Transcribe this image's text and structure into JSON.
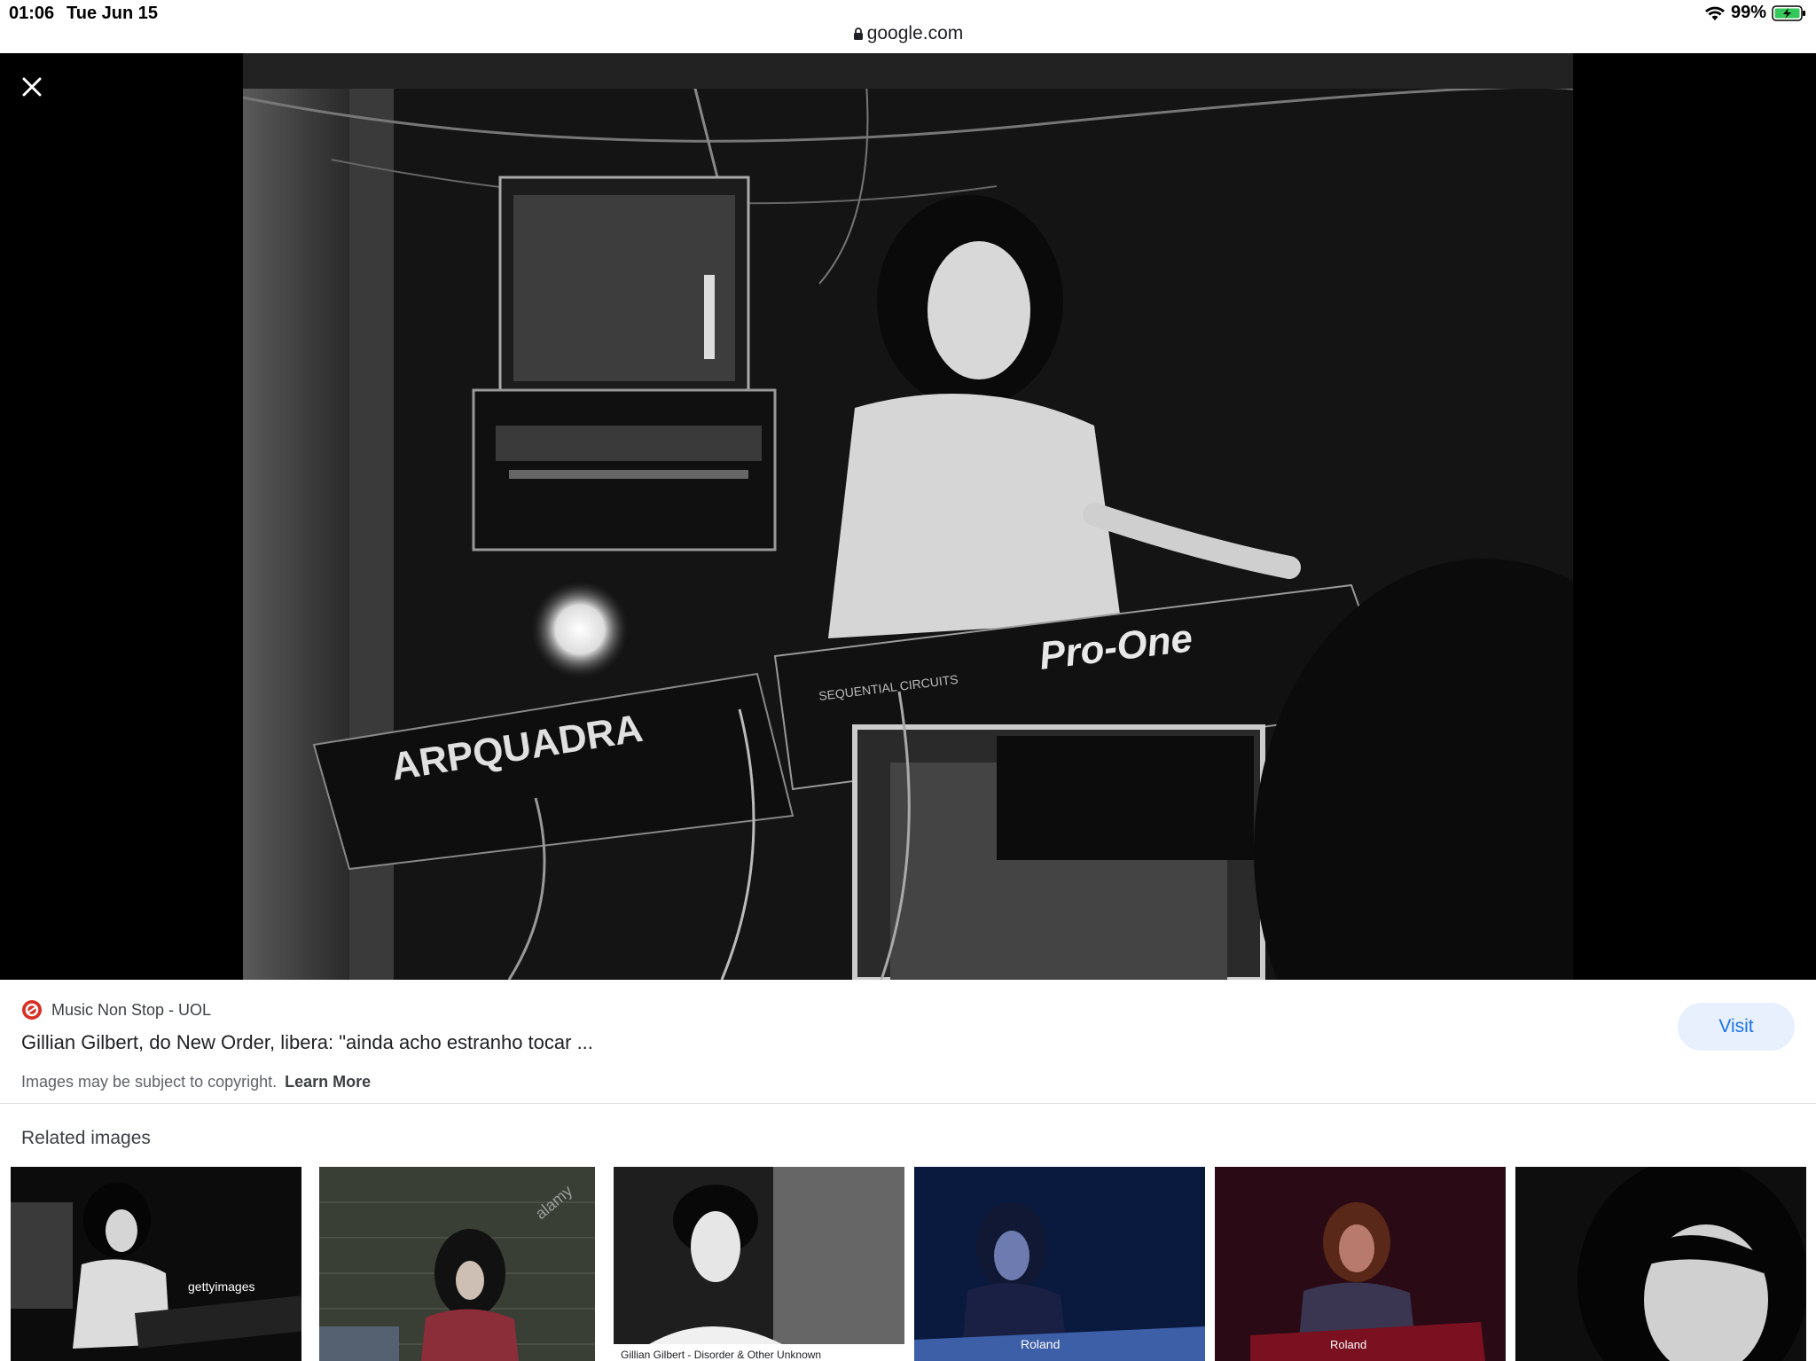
{
  "status_bar": {
    "time": "01:06",
    "date": "Tue Jun 15",
    "battery": "99%"
  },
  "url_bar": {
    "domain": "google.com"
  },
  "viewer": {
    "image_text": {
      "keyboard_brand": "ARPQUADRA",
      "synth_model": "Pro-One",
      "synth_maker": "SEQUENTIAL CIRCUITS"
    }
  },
  "result": {
    "source": "Music Non Stop - UOL",
    "title": "Gillian Gilbert, do New Order, libera: \"ainda acho estranho tocar ...",
    "copyright": "Images may be subject to copyright.",
    "learn_more": "Learn More",
    "visit_label": "Visit"
  },
  "related": {
    "heading": "Related images",
    "thumbs": [
      {
        "watermark": "gettyimages"
      },
      {
        "watermark": "alamy"
      },
      {
        "caption": "Gillian Gilbert - Disorder & Other Unknown"
      },
      {
        "keyboard_text": "Roland"
      },
      {
        "keyboard_text": "Roland"
      },
      {}
    ]
  },
  "colors": {
    "accent": "#1a73e8",
    "visit_bg": "#e8f0fe",
    "battery_green": "#34c759",
    "source_logo": "#d93025"
  }
}
